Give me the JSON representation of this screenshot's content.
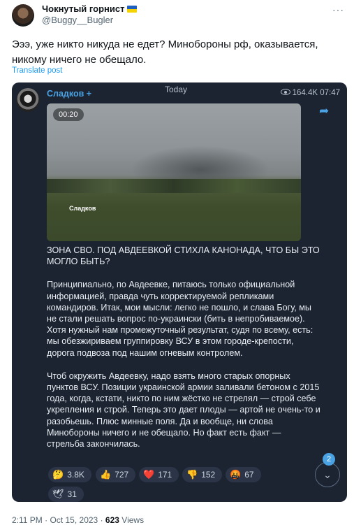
{
  "tweet": {
    "author_name": "Чокнутый горнист",
    "author_handle": "@Buggy__Bugler",
    "more_icon": "more-icon",
    "text": "Эээ, уже никто никуда не едет? Минобороны рф, оказывается, никому ничего не обещало.",
    "translate_label": "Translate post",
    "time": "2:11 PM",
    "separator": "·",
    "date": "Oct 15, 2023",
    "views_count": "623",
    "views_label": "Views"
  },
  "telegram": {
    "channel": "Сладков +",
    "date_label": "Today",
    "views": "164.4K",
    "time": "07:47",
    "share_icon": "share-arrow-icon",
    "video": {
      "duration": "00:20",
      "watermark": "Сладков"
    },
    "paragraphs": [
      "ЗОНА СВО. ПОД АВДЕЕВКОЙ СТИХЛА КАНОНАДА, ЧТО БЫ ЭТО МОГЛО БЫТЬ?",
      "Принципиально, по Авдеевке, питаюсь только официальной информацией, правда чуть корректируемой репликами командиров. Итак, мои мысли: легко не пошло, и слава Богу, мы не стали решать вопрос по-украински (бить в непробиваемое). Хотя нужный нам промежуточный результат, судя по всему, есть: мы обезжириваем группировку ВСУ в этом городе-крепости, дорога подвоза под нашим огневым контролем.",
      "Чтоб окружить Авдеевку, надо взять много старых опорных пунктов ВСУ. Позиции украинской армии заливали бетоном с 2015 года, когда, кстати, никто по ним жёстко не стрелял — строй себе укрепления и строй. Теперь это дает плоды — артой не очень-то и разобьешь. Плюс минные поля. Да и вообще, ни слова Минобороны ничего и не обещало. Но факт есть факт — стрельба закончилась."
    ],
    "reactions": [
      {
        "emoji": "🤔",
        "count": "3.8K"
      },
      {
        "emoji": "👍",
        "count": "727"
      },
      {
        "emoji": "❤️",
        "count": "171"
      },
      {
        "emoji": "👎",
        "count": "152"
      },
      {
        "emoji": "🤬",
        "count": "67"
      },
      {
        "emoji": "🕊",
        "count": "31"
      }
    ],
    "unread_badge": "2",
    "scroll_down_icon": "chevron-down-icon"
  },
  "colors": {
    "card_bg": "#1c2432",
    "accent": "#4aa2e3",
    "link": "#1d9bf0"
  }
}
